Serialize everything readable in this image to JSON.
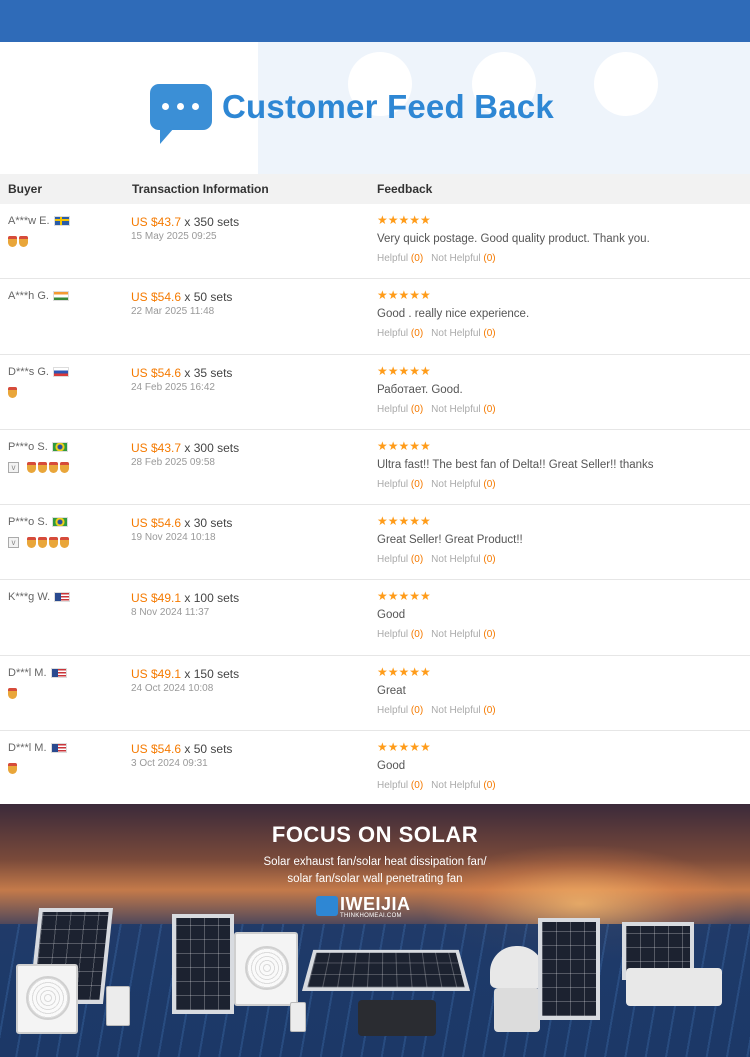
{
  "header": {
    "title": "Customer Feed Back",
    "icon": "chat-bubble-icon",
    "accent_color": "#2e87d4"
  },
  "table": {
    "columns": [
      "Buyer",
      "Transaction Information",
      "Feedback"
    ],
    "helpful_label": "Helpful",
    "not_helpful_label": "Not Helpful",
    "rows": [
      {
        "buyer": "A***w E.",
        "country_flag": "sweden-flag-icon",
        "badges": 2,
        "vip": false,
        "price": "US $43.7",
        "qty": " x 350 sets",
        "date": "15 May 2025 09:25",
        "rating": 5,
        "comment": "Very quick postage. Good quality product. Thank you.",
        "helpful": "(0)",
        "not_helpful": "(0)"
      },
      {
        "buyer": "A***h G.",
        "country_flag": "india-flag-icon",
        "badges": 0,
        "vip": false,
        "price": "US $54.6",
        "qty": " x 50 sets",
        "date": "22 Mar 2025 11:48",
        "rating": 5,
        "comment": "Good . really nice experience.",
        "helpful": "(0)",
        "not_helpful": "(0)"
      },
      {
        "buyer": "D***s G.",
        "country_flag": "russia-flag-icon",
        "badges": 1,
        "vip": false,
        "price": "US $54.6",
        "qty": " x 35 sets",
        "date": "24 Feb 2025 16:42",
        "rating": 5,
        "comment": "Работает. Good.",
        "helpful": "(0)",
        "not_helpful": "(0)"
      },
      {
        "buyer": "P***o S.",
        "country_flag": "brazil-flag-icon",
        "badges": 4,
        "vip": true,
        "price": "US $43.7",
        "qty": " x 300 sets",
        "date": "28 Feb 2025 09:58",
        "rating": 5,
        "comment": "Ultra fast!! The best fan of Delta!! Great Seller!! thanks",
        "helpful": "(0)",
        "not_helpful": "(0)"
      },
      {
        "buyer": "P***o S.",
        "country_flag": "brazil-flag-icon",
        "badges": 4,
        "vip": true,
        "price": "US $54.6",
        "qty": " x 30 sets",
        "date": "19 Nov 2024 10:18",
        "rating": 5,
        "comment": "Great Seller! Great Product!!",
        "helpful": "(0)",
        "not_helpful": "(0)"
      },
      {
        "buyer": "K***g W.",
        "country_flag": "usa-flag-icon",
        "badges": 0,
        "vip": false,
        "price": "US $49.1",
        "qty": " x 100 sets",
        "date": "8 Nov 2024 11:37",
        "rating": 5,
        "comment": "Good",
        "helpful": "(0)",
        "not_helpful": "(0)"
      },
      {
        "buyer": "D***l M.",
        "country_flag": "usa-flag-icon",
        "badges": 1,
        "vip": false,
        "price": "US $49.1",
        "qty": " x 150 sets",
        "date": "24 Oct 2024 10:08",
        "rating": 5,
        "comment": "Great",
        "helpful": "(0)",
        "not_helpful": "(0)"
      },
      {
        "buyer": "D***l M.",
        "country_flag": "usa-flag-icon",
        "badges": 1,
        "vip": false,
        "price": "US $54.6",
        "qty": " x 50 sets",
        "date": "3 Oct 2024 09:31",
        "rating": 5,
        "comment": "Good",
        "helpful": "(0)",
        "not_helpful": "(0)"
      }
    ]
  },
  "banner": {
    "title": "FOCUS ON SOLAR",
    "subtitle_line1": "Solar exhaust fan/solar heat dissipation fan/",
    "subtitle_line2": "solar fan/solar wall penetrating fan",
    "logo_text": "IWEIJIA",
    "logo_url": "THINKHOMEAI.COM"
  },
  "colors": {
    "top_bar": "#2f6bb8",
    "price": "#f57a00",
    "stars": "#ff9c1a"
  }
}
